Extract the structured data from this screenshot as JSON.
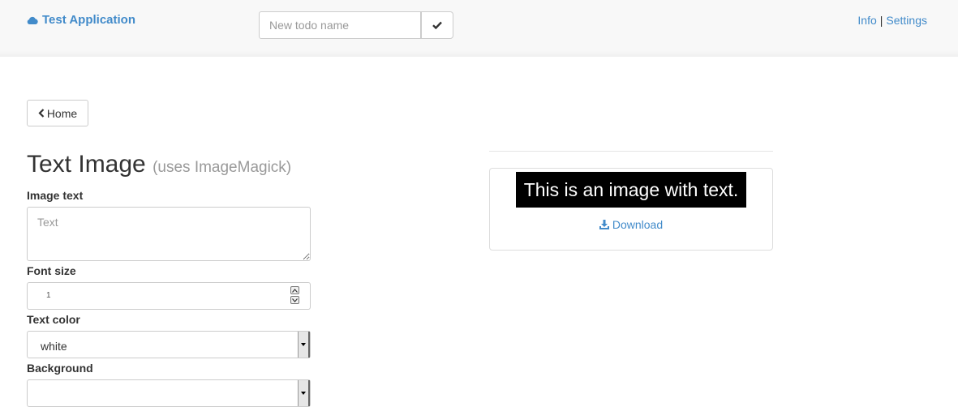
{
  "header": {
    "brand": "Test Application",
    "todo_placeholder": "New todo name",
    "links": {
      "info": "Info",
      "separator": "|",
      "settings": "Settings"
    }
  },
  "nav": {
    "home_label": "Home"
  },
  "page": {
    "title": "Text Image",
    "subtitle": "(uses ImageMagick)"
  },
  "form": {
    "image_text": {
      "label": "Image text",
      "placeholder": "Text"
    },
    "font_size": {
      "label": "Font size",
      "value": "1"
    },
    "text_color": {
      "label": "Text color",
      "value": "white"
    },
    "background": {
      "label": "Background",
      "value": ""
    }
  },
  "preview": {
    "image_text": "This is an image with text.",
    "download_label": "Download"
  },
  "colors": {
    "link": "#428bca",
    "navbar": "#f8f8f8",
    "image_bg": "#000000",
    "image_fg": "#ffffff"
  },
  "icons": {
    "brand": "cloud-icon",
    "submit": "checkmark-icon",
    "home": "chevron-left-icon",
    "download": "download-icon"
  }
}
